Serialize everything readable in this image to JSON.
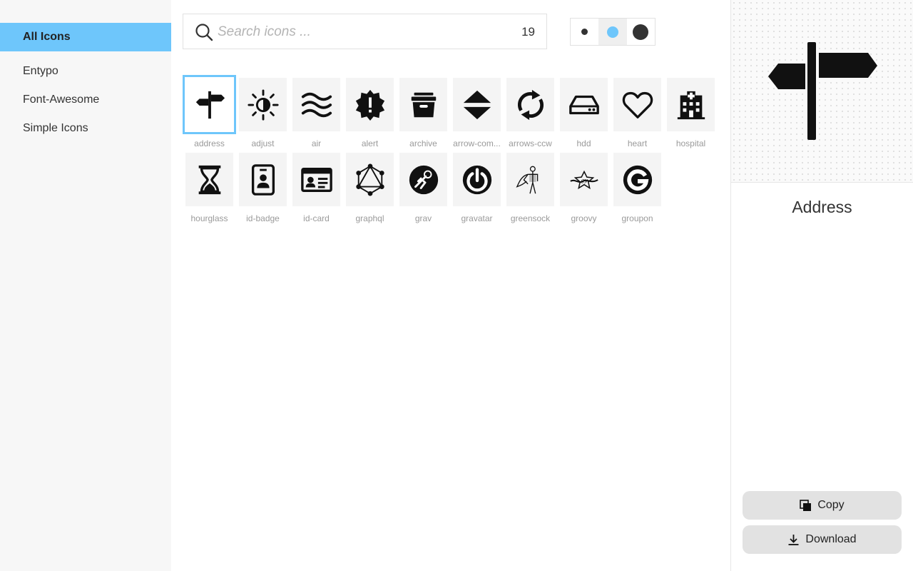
{
  "sidebar": {
    "items": [
      {
        "label": "All Icons",
        "active": true
      },
      {
        "label": "Entypo",
        "active": false
      },
      {
        "label": "Font-Awesome",
        "active": false
      },
      {
        "label": "Simple Icons",
        "active": false
      }
    ]
  },
  "search": {
    "placeholder": "Search icons ...",
    "value": "",
    "count": "19",
    "icon": "search-icon"
  },
  "size_picker": {
    "options": [
      "small",
      "medium",
      "large"
    ],
    "selected": "medium",
    "accent": "#6ec6fb"
  },
  "icons": [
    {
      "label": "address",
      "icon": "signpost-icon",
      "selected": true
    },
    {
      "label": "adjust",
      "icon": "brightness-icon"
    },
    {
      "label": "air",
      "icon": "air-waves-icon"
    },
    {
      "label": "alert",
      "icon": "alert-badge-icon"
    },
    {
      "label": "archive",
      "icon": "archive-box-icon"
    },
    {
      "label": "arrow-com...",
      "icon": "arrow-combo-icon"
    },
    {
      "label": "arrows-ccw",
      "icon": "arrows-ccw-icon"
    },
    {
      "label": "hdd",
      "icon": "hard-drive-icon"
    },
    {
      "label": "heart",
      "icon": "heart-outline-icon"
    },
    {
      "label": "hospital",
      "icon": "hospital-icon"
    },
    {
      "label": "hourglass",
      "icon": "hourglass-icon"
    },
    {
      "label": "id-badge",
      "icon": "id-badge-icon"
    },
    {
      "label": "id-card",
      "icon": "id-card-icon"
    },
    {
      "label": "graphql",
      "icon": "graphql-logo-icon"
    },
    {
      "label": "grav",
      "icon": "grav-logo-icon"
    },
    {
      "label": "gravatar",
      "icon": "gravatar-logo-icon"
    },
    {
      "label": "greensock",
      "icon": "greensock-logo-icon"
    },
    {
      "label": "groovy",
      "icon": "groovy-logo-icon"
    },
    {
      "label": "groupon",
      "icon": "groupon-logo-icon"
    }
  ],
  "detail": {
    "title": "Address",
    "preview_icon": "signpost-icon",
    "copy_label": "Copy",
    "download_label": "Download"
  },
  "colors": {
    "accent": "#6ec6fb",
    "sidebar_bg": "#f7f7f7",
    "tile_bg": "#f4f4f4"
  }
}
